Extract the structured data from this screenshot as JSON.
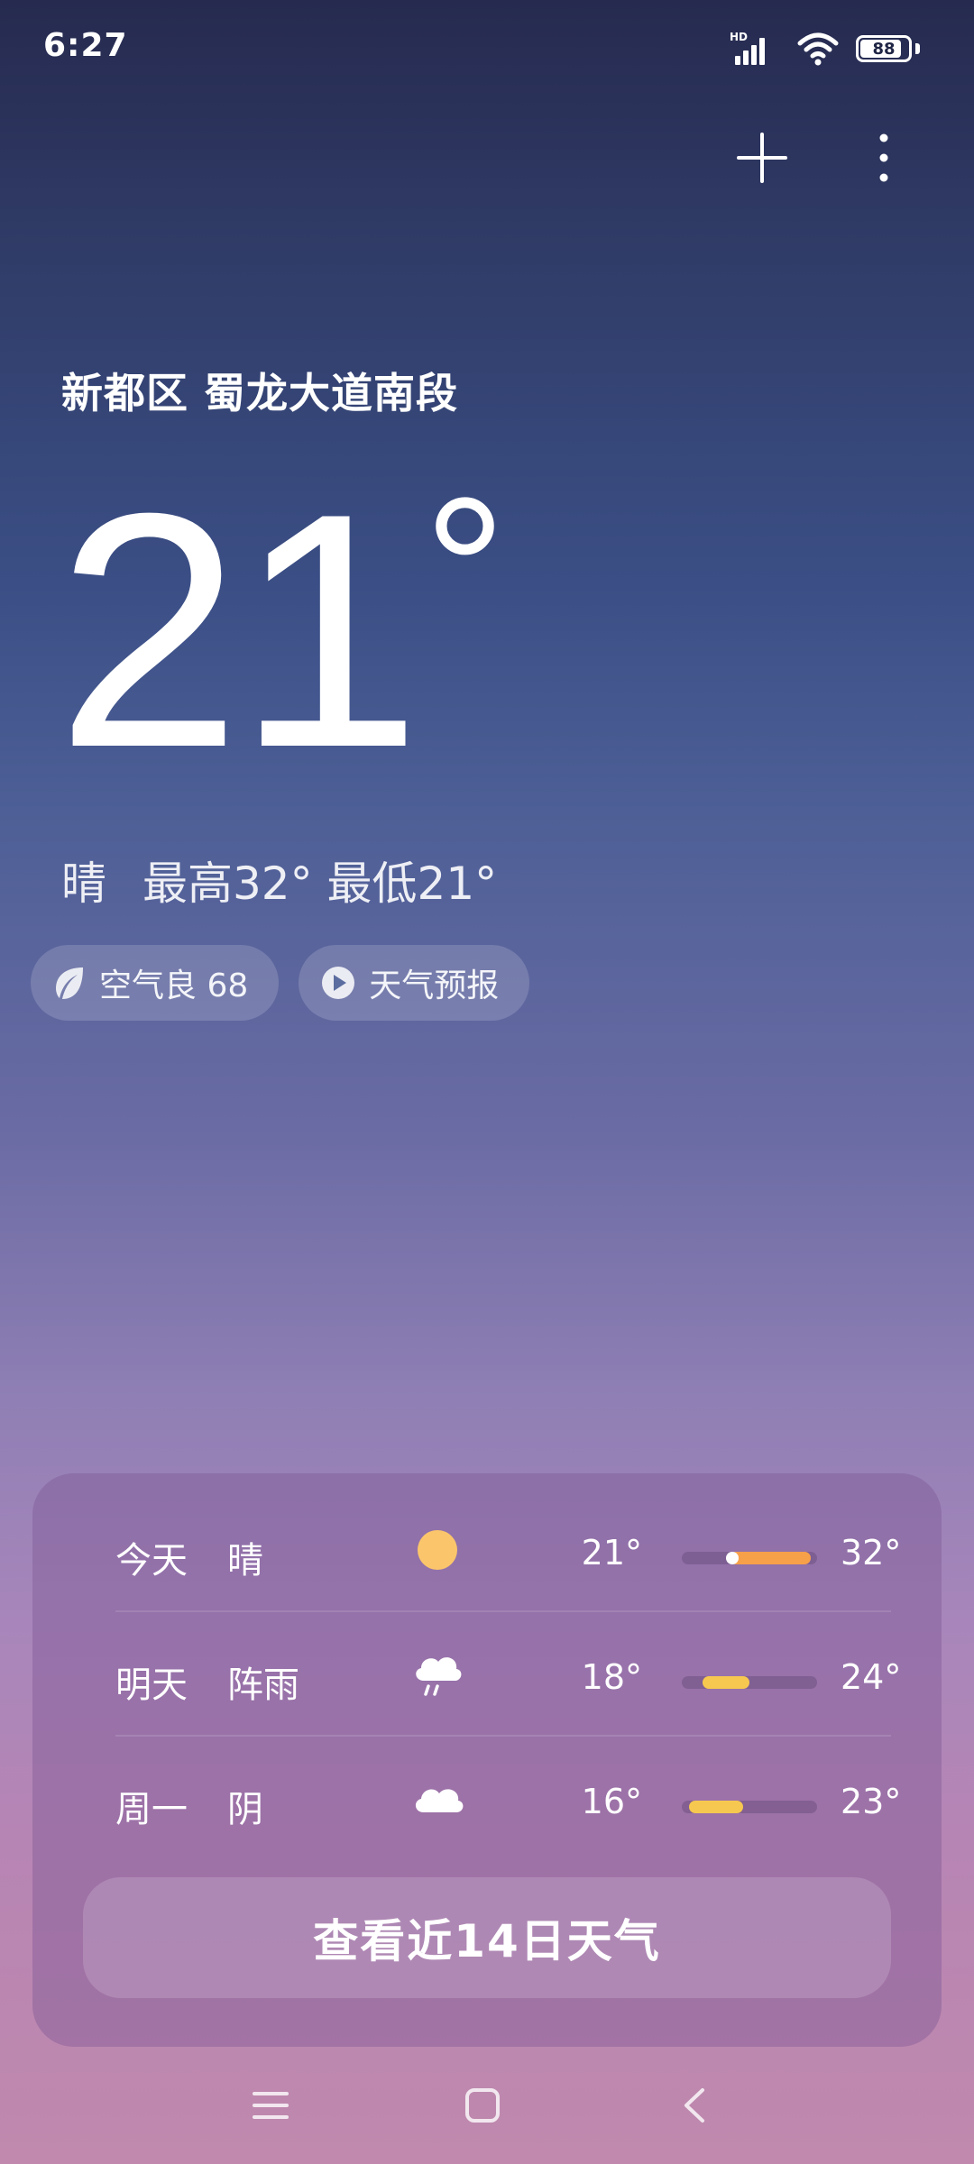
{
  "status_bar": {
    "time": "6:27",
    "network_badge": "HD",
    "battery_level": "88"
  },
  "location": {
    "text": "新都区 蜀龙大道南段"
  },
  "current": {
    "temperature": "21",
    "unit": "°",
    "condition": "晴",
    "high_low": "最高32° 最低21°"
  },
  "chips": [
    {
      "label": "空气良 68",
      "icon": "leaf-icon"
    },
    {
      "label": "天气预报",
      "icon": "play-icon"
    }
  ],
  "forecast": [
    {
      "day": "今天",
      "condition": "晴",
      "icon": "sun-icon",
      "low": "21°",
      "high": "32°",
      "range_start": 0.35,
      "range_end": 0.95,
      "now": 0.35,
      "color": "#f7a04a"
    },
    {
      "day": "明天",
      "condition": "阵雨",
      "icon": "rain-cloud-icon",
      "low": "18°",
      "high": "24°",
      "range_start": 0.15,
      "range_end": 0.5,
      "color": "#f6c850"
    },
    {
      "day": "周一",
      "condition": "阴",
      "icon": "cloud-icon",
      "low": "16°",
      "high": "23°",
      "range_start": 0.05,
      "range_end": 0.45,
      "color": "#f6c850"
    }
  ],
  "cta": {
    "label": "查看近14日天气"
  },
  "colors": {
    "sun": "#fbc66b",
    "range_warm": "#f7a04a",
    "range_mild": "#f6c850"
  }
}
